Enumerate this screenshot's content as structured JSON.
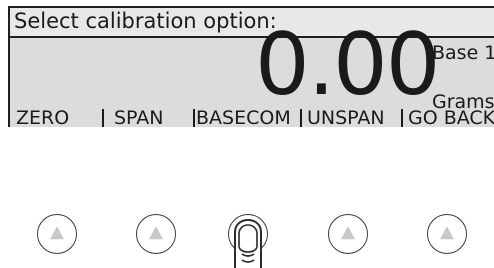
{
  "display": {
    "prompt": "Select calibration option:",
    "reading": "0.00",
    "base": "Base 1",
    "unit": "Grams"
  },
  "softkeys": [
    {
      "label": "ZERO"
    },
    {
      "label": "SPAN"
    },
    {
      "label": "BASECOM"
    },
    {
      "label": "UNSPAN"
    },
    {
      "label": "GO BACK"
    }
  ],
  "pressed_button_index": 2,
  "colors": {
    "lcd_background": "#dcdcdc",
    "text": "#1a1a1a",
    "arrow": "#c8c8c8"
  }
}
